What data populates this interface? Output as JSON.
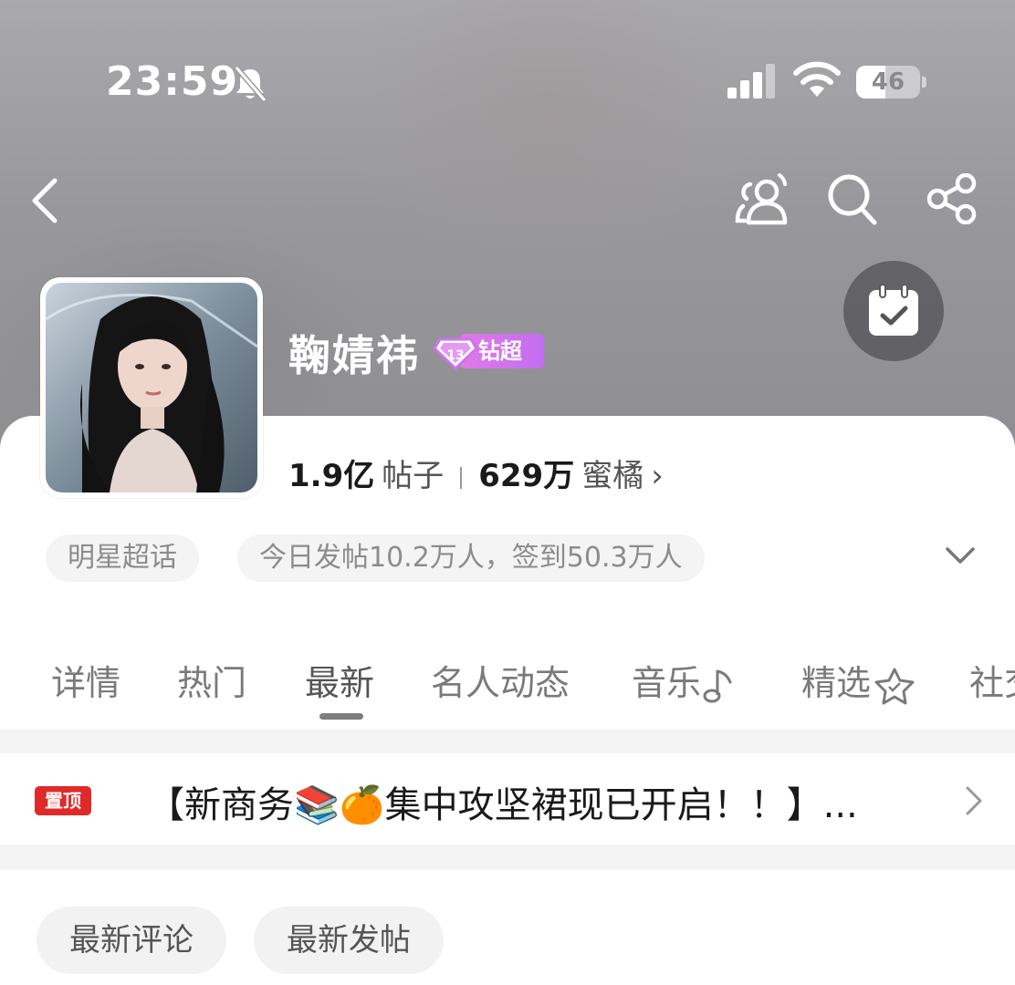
{
  "status_bar": {
    "time": "23:59",
    "battery": "46",
    "battery_level": 0.46
  },
  "profile": {
    "name": "鞠婧祎",
    "badge_label": "钻超",
    "posts_value": "1.9亿",
    "posts_label": "帖子",
    "fans_value": "629万",
    "fans_label": "蜜橘",
    "fans_chevron": "›"
  },
  "tags": [
    "明星超话",
    "今日发帖10.2万人，签到50.3万人"
  ],
  "tabs": [
    {
      "label": "详情",
      "icon": ""
    },
    {
      "label": "热门",
      "icon": ""
    },
    {
      "label": "最新",
      "icon": ""
    },
    {
      "label": "名人动态",
      "icon": ""
    },
    {
      "label": "音乐",
      "icon": "music-note-icon"
    },
    {
      "label": "精选",
      "icon": "star-badge-icon"
    },
    {
      "label": "社交",
      "icon": ""
    }
  ],
  "active_tab": "最新",
  "pinned": {
    "badge": "置顶",
    "text": "【新商务📚🍊集中攻坚裙现已开启！！】..."
  },
  "filters": [
    "最新评论",
    "最新发帖"
  ],
  "colors": {
    "pin_red": "#e02a2a",
    "badge_purple": "#c16ef0",
    "header_gray": "#98989c"
  }
}
